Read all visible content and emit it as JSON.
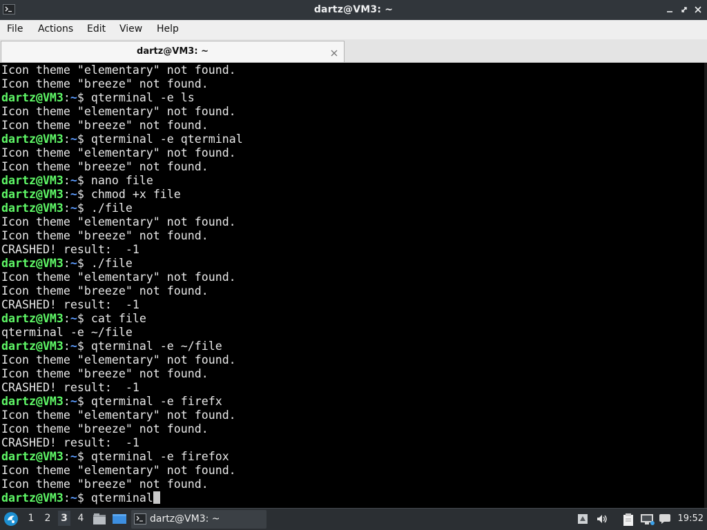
{
  "window": {
    "title": "dartz@VM3: ~"
  },
  "menu": {
    "items": [
      "File",
      "Actions",
      "Edit",
      "View",
      "Help"
    ]
  },
  "tabs": [
    {
      "label": "dartz@VM3: ~"
    }
  ],
  "terminal": {
    "prompt_user": "dartz@VM3",
    "prompt_sep": ":",
    "prompt_path": "~",
    "prompt_symbol": "$ ",
    "lines": [
      {
        "text": "Icon theme \"elementary\" not found."
      },
      {
        "text": "Icon theme \"breeze\" not found."
      },
      {
        "prompt": true,
        "text": "qterminal -e ls"
      },
      {
        "text": "Icon theme \"elementary\" not found."
      },
      {
        "text": "Icon theme \"breeze\" not found."
      },
      {
        "prompt": true,
        "text": "qterminal -e qterminal"
      },
      {
        "text": "Icon theme \"elementary\" not found."
      },
      {
        "text": "Icon theme \"breeze\" not found."
      },
      {
        "prompt": true,
        "text": "nano file"
      },
      {
        "prompt": true,
        "text": "chmod +x file"
      },
      {
        "prompt": true,
        "text": "./file"
      },
      {
        "text": "Icon theme \"elementary\" not found."
      },
      {
        "text": "Icon theme \"breeze\" not found."
      },
      {
        "text": "CRASHED! result:  -1"
      },
      {
        "prompt": true,
        "text": "./file"
      },
      {
        "text": "Icon theme \"elementary\" not found."
      },
      {
        "text": "Icon theme \"breeze\" not found."
      },
      {
        "text": "CRASHED! result:  -1"
      },
      {
        "prompt": true,
        "text": "cat file"
      },
      {
        "text": "qterminal -e ~/file"
      },
      {
        "prompt": true,
        "text": "qterminal -e ~/file"
      },
      {
        "text": "Icon theme \"elementary\" not found."
      },
      {
        "text": "Icon theme \"breeze\" not found."
      },
      {
        "text": "CRASHED! result:  -1"
      },
      {
        "prompt": true,
        "text": "qterminal -e firefx"
      },
      {
        "text": "Icon theme \"elementary\" not found."
      },
      {
        "text": "Icon theme \"breeze\" not found."
      },
      {
        "text": "CRASHED! result:  -1"
      },
      {
        "prompt": true,
        "text": "qterminal -e firefox"
      },
      {
        "text": "Icon theme \"elementary\" not found."
      },
      {
        "text": "Icon theme \"breeze\" not found."
      },
      {
        "prompt": true,
        "text": "qterminal",
        "cursor": true
      }
    ]
  },
  "taskbar": {
    "desktops": [
      "1",
      "2",
      "3",
      "4"
    ],
    "active_desktop": "3",
    "task_label": "dartz@VM3: ~",
    "clock": "19:52",
    "icons": [
      "start-menu-icon",
      "file-manager-icon",
      "show-desktop-icon",
      "terminal-icon",
      "speaker-icon",
      "volume-icon",
      "clipboard-icon",
      "network-icon"
    ]
  },
  "colors": {
    "prompt_user": "#5ff967",
    "prompt_path": "#5c9cff",
    "terminal_bg": "#000000",
    "terminal_fg": "#e8e8e8",
    "titlebar_bg": "#31363b",
    "taskbar_bg": "#2b2f33"
  }
}
